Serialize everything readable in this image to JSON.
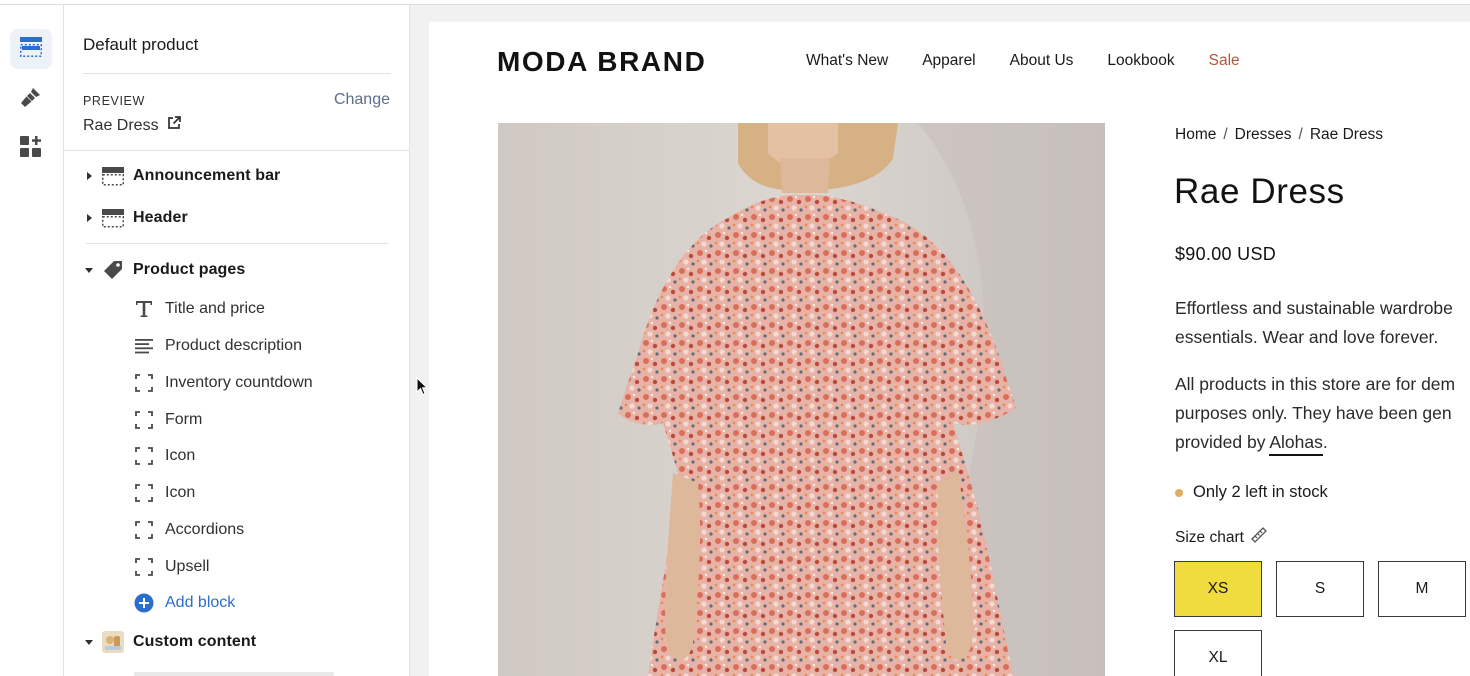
{
  "rail": {
    "items": [
      {
        "name": "sections",
        "icon": "layout-icon",
        "active": true
      },
      {
        "name": "theme-settings",
        "icon": "paintbrush-icon",
        "active": false
      },
      {
        "name": "app-embeds",
        "icon": "apps-add-icon",
        "active": false
      }
    ]
  },
  "sidebar": {
    "template_title": "Default product",
    "preview_label": "PREVIEW",
    "change_label": "Change",
    "preview_product": "Rae Dress",
    "sections": [
      {
        "label": "Announcement bar",
        "icon": "section-layout-icon",
        "expanded": false
      },
      {
        "label": "Header",
        "icon": "section-layout-icon",
        "expanded": false
      },
      {
        "label": "Product pages",
        "icon": "tag-icon",
        "expanded": true
      },
      {
        "label": "Custom content",
        "icon": "image-icon",
        "expanded": true
      }
    ],
    "blocks": [
      {
        "label": "Title and price",
        "icon": "text-icon"
      },
      {
        "label": "Product description",
        "icon": "paragraph-icon"
      },
      {
        "label": "Inventory countdown",
        "icon": "block-icon"
      },
      {
        "label": "Form",
        "icon": "block-icon"
      },
      {
        "label": "Icon",
        "icon": "block-icon"
      },
      {
        "label": "Icon",
        "icon": "block-icon"
      },
      {
        "label": "Accordions",
        "icon": "block-icon"
      },
      {
        "label": "Upsell",
        "icon": "block-icon"
      }
    ],
    "add_block_label": "Add block"
  },
  "store": {
    "brand": "MODA BRAND",
    "nav": [
      "What's New",
      "Apparel",
      "About Us",
      "Lookbook",
      "Sale"
    ],
    "breadcrumb": [
      "Home",
      "Dresses",
      "Rae Dress"
    ],
    "breadcrumb_separator": "/",
    "product_title": "Rae Dress",
    "price": "$90.00 USD",
    "description_line1": "Effortless and sustainable wardrobe",
    "description_line2": "essentials. Wear and love forever.",
    "disclaimer_line1": "All products in this store are for dem",
    "disclaimer_line2": "purposes only. They have been gen",
    "disclaimer_line3_prefix": "provided by ",
    "disclaimer_link": "Alohas",
    "disclaimer_line3_suffix": ".",
    "stock_text": "Only 2 left in stock",
    "size_chart_label": "Size chart",
    "sizes": [
      "XS",
      "S",
      "M",
      "XL"
    ],
    "selected_size": "XS",
    "colors": {
      "accent_size": "#f0dc3e",
      "sale": "#b4563a",
      "stock_dot": "#e0ad5f",
      "link": "#2c6ecb"
    }
  }
}
